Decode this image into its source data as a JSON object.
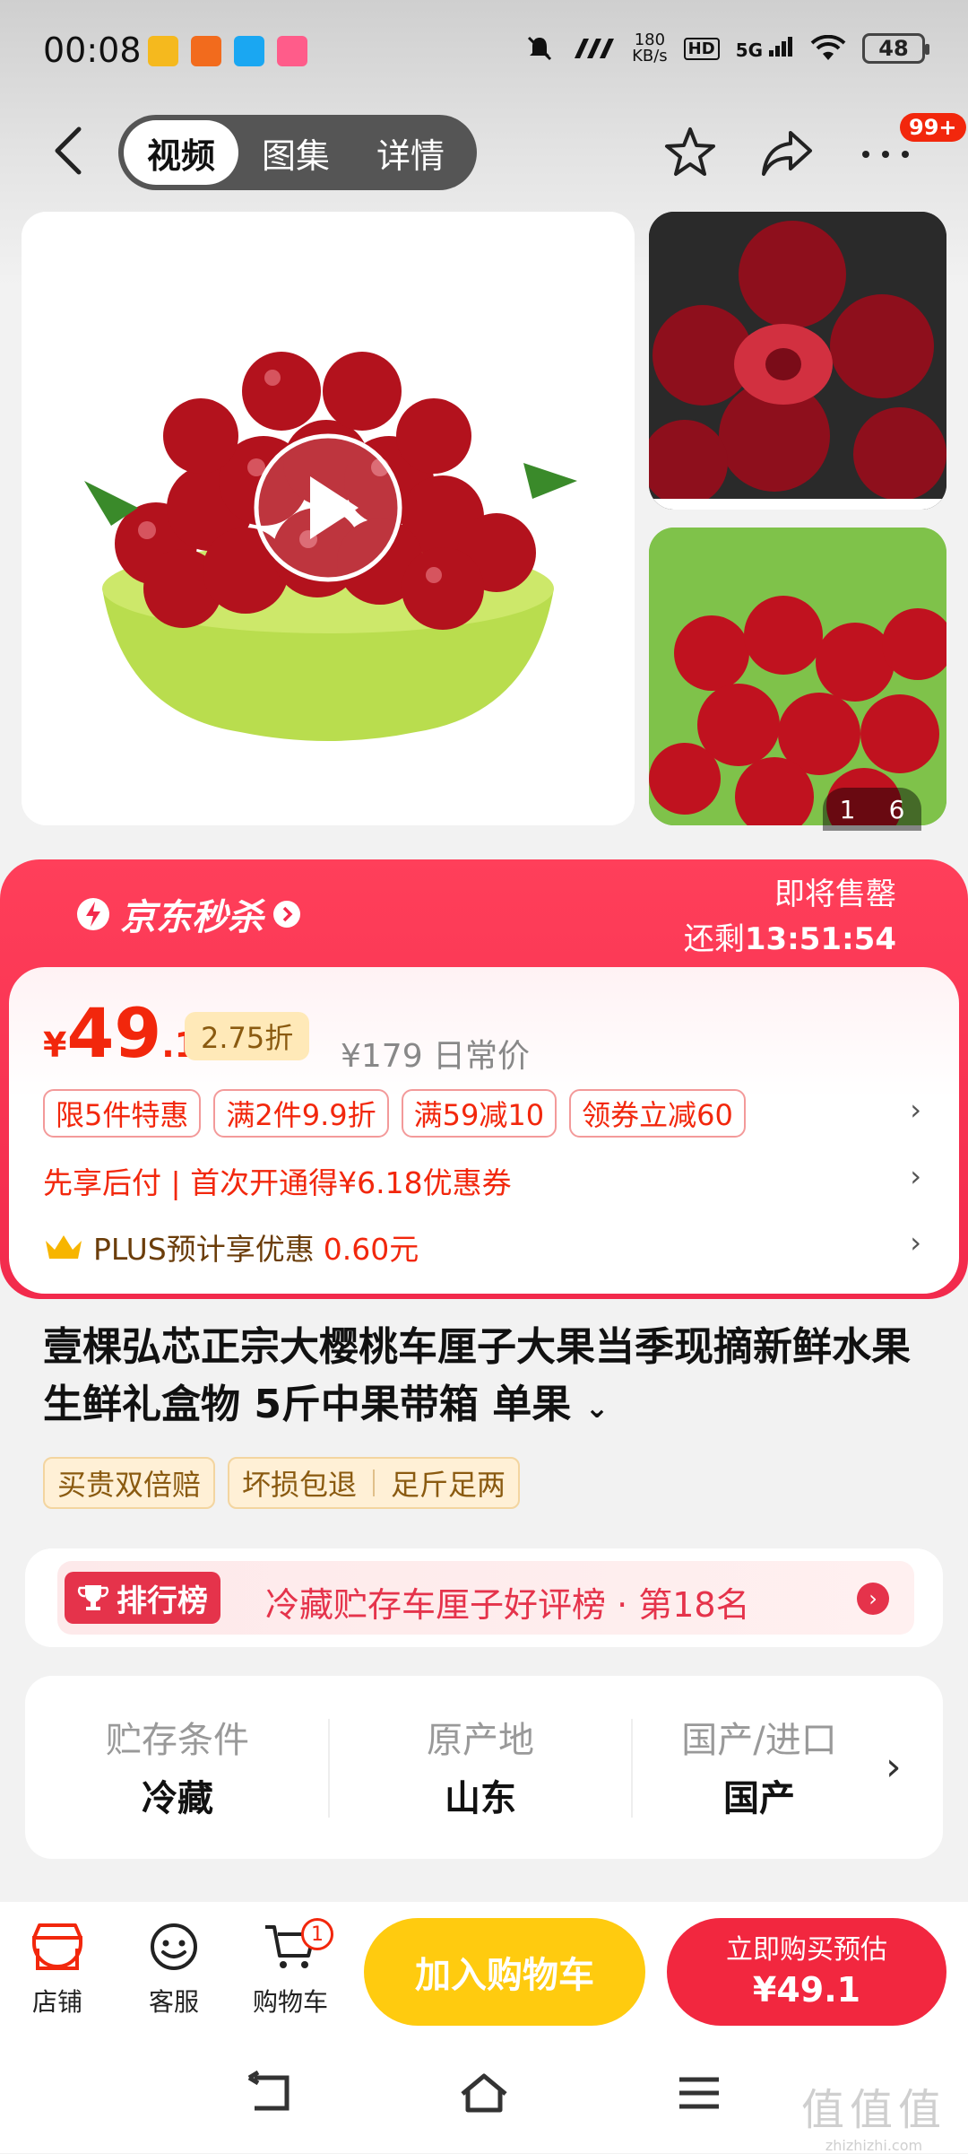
{
  "status_bar": {
    "time": "00:08",
    "net_speed_value": "180",
    "net_speed_unit": "KB/s",
    "hd": "HD",
    "signal": "5G",
    "battery": "48"
  },
  "nav": {
    "tabs": [
      {
        "label": "视频",
        "active": true
      },
      {
        "label": "图集",
        "active": false
      },
      {
        "label": "详情",
        "active": false
      }
    ],
    "message_badge": "99+"
  },
  "gallery": {
    "counter_current": "1",
    "counter_total": "6"
  },
  "flash_sale": {
    "title": "京东秒杀",
    "status": "即将售罄",
    "remaining_prefix": "还剩",
    "countdown": "13:51:54"
  },
  "price": {
    "currency": "¥",
    "integer": "49",
    "decimal": ".1",
    "discount": "2.75折",
    "original": "¥179 日常价"
  },
  "promotions": [
    "限5件特惠",
    "满2件9.9折",
    "满59减10",
    "领券立减60"
  ],
  "credit_pay": "先享后付 | 首次开通得¥6.18优惠券",
  "plus": {
    "label": "PLUS预计享优惠",
    "amount": "0.60元"
  },
  "product": {
    "title": "壹棵弘芯正宗大樱桃车厘子大果当季现摘新鲜水果生鲜礼盒物 5斤中果带箱 单果"
  },
  "services": {
    "tag1": "买贵双倍赔",
    "tag2a": "坏损包退",
    "tag2b": "足斤足两"
  },
  "ranking": {
    "badge": "排行榜",
    "text": "冷藏贮存车厘子好评榜 · 第18名"
  },
  "specs": [
    {
      "label": "贮存条件",
      "value": "冷藏"
    },
    {
      "label": "原产地",
      "value": "山东"
    },
    {
      "label": "国产/进口",
      "value": "国产"
    }
  ],
  "action_bar": {
    "store": "店铺",
    "service": "客服",
    "cart": "购物车",
    "cart_count": "1",
    "add_to_cart": "加入购物车",
    "buy_label": "立即购买预估",
    "buy_price": "¥49.1"
  },
  "watermark": {
    "big": "值值值",
    "small": "zhizhizhi.com"
  },
  "colors": {
    "accent_red": "#f2270c",
    "flash_red": "#f22a4c",
    "cart_yellow": "#ffcb0f"
  }
}
